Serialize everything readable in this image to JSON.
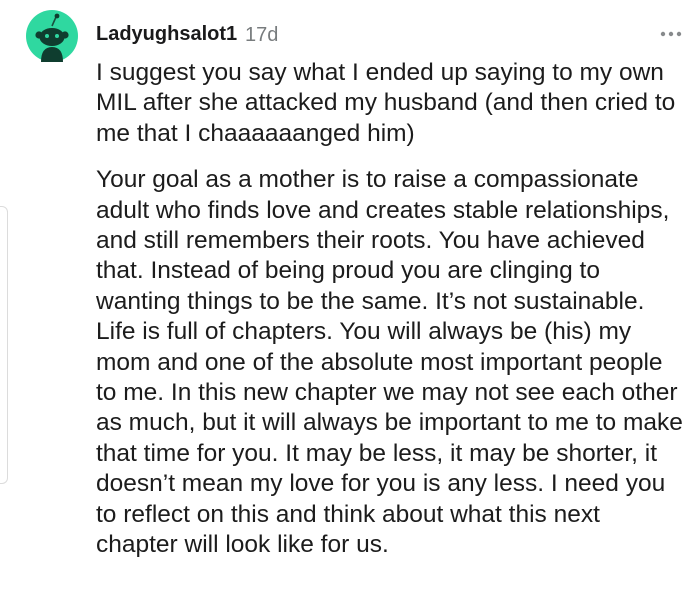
{
  "comment": {
    "username": "Ladyughsalot1",
    "timestamp": "17d",
    "avatar_icon": "snoo-avatar-icon",
    "more_icon": "more-options-icon",
    "colors": {
      "avatar_bg": "#2fd8a0",
      "username": "#1a1a1b",
      "meta": "#787c7e",
      "text": "#1c1c1c"
    },
    "paragraphs": [
      "I suggest you say what I ended up saying to my own MIL after she attacked my husband (and then cried to me that I chaaaaaanged him)",
      "Your goal as a mother is to raise a compassionate adult who finds love and creates stable relationships, and still remembers their roots. You have achieved that. Instead of being proud you are clinging to wanting things to be the same. It’s not sustainable. Life is full of chapters. You will always be (his) my mom and one of the absolute most important people to me. In this new chapter we may not see each other as much, but it will always be important to me to make that time for you. It may be less, it may be shorter, it doesn’t mean my love for you is any less. I need you to reflect on this and think about what this next chapter will look like for us."
    ]
  }
}
